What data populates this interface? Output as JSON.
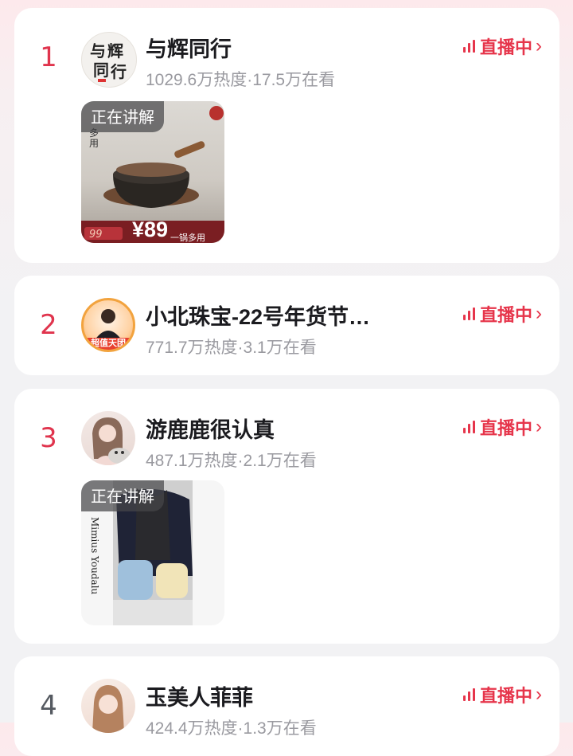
{
  "colors": {
    "accent": "#e6354b",
    "rank_top": "#e0344d",
    "rank_other": "#555a61"
  },
  "rankings": [
    {
      "rank": "1",
      "name": "与辉同行",
      "stats": "1029.6万热度·17.5万在看",
      "live_label": "直播中",
      "explaining_tag": "正在讲解",
      "price": "¥89",
      "promo": "一锅多用",
      "promo_side": "多用"
    },
    {
      "rank": "2",
      "name": "小北珠宝-22号年货节…",
      "stats": "771.7万热度·3.1万在看",
      "live_label": "直播中",
      "avatar_badge": "超值天团"
    },
    {
      "rank": "3",
      "name": "游鹿鹿很认真",
      "stats": "487.1万热度·2.1万在看",
      "live_label": "直播中",
      "explaining_tag": "正在讲解",
      "side_text": "Mimius Youdalu"
    },
    {
      "rank": "4",
      "name": "玉美人菲菲",
      "stats": "424.4万热度·1.3万在看",
      "live_label": "直播中"
    }
  ]
}
